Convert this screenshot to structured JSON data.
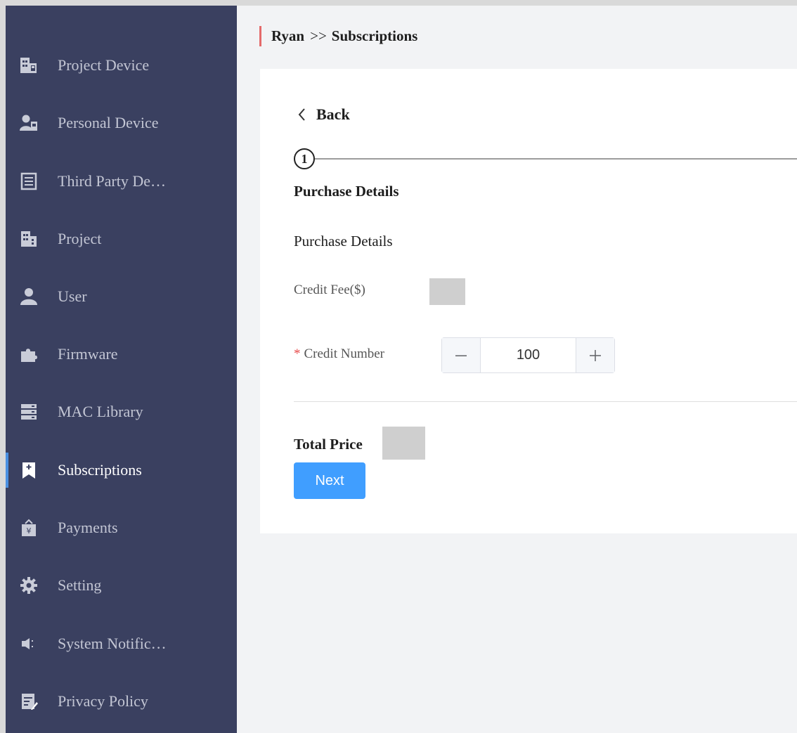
{
  "sidebar": {
    "items": [
      {
        "label": "Project Device",
        "icon": "building-device-icon"
      },
      {
        "label": "Personal Device",
        "icon": "person-device-icon"
      },
      {
        "label": "Third Party De…",
        "icon": "third-party-device-icon"
      },
      {
        "label": "Project",
        "icon": "building-icon"
      },
      {
        "label": "User",
        "icon": "user-icon"
      },
      {
        "label": "Firmware",
        "icon": "puzzle-icon"
      },
      {
        "label": "MAC Library",
        "icon": "server-icon"
      },
      {
        "label": "Subscriptions",
        "icon": "bookmark-plus-icon",
        "active": true
      },
      {
        "label": "Payments",
        "icon": "payment-bag-icon"
      },
      {
        "label": "Setting",
        "icon": "gear-icon"
      },
      {
        "label": "System Notific…",
        "icon": "speaker-icon"
      },
      {
        "label": "Privacy Policy",
        "icon": "policy-document-icon"
      }
    ]
  },
  "breadcrumb": {
    "user": "Ryan",
    "separator": ">>",
    "page": "Subscriptions"
  },
  "back": {
    "label": "Back"
  },
  "steps": {
    "current_number": "1",
    "title": "Purchase Details"
  },
  "form": {
    "section_title": "Purchase Details",
    "credit_fee_label": "Credit Fee($)",
    "credit_number_required_mark": "*",
    "credit_number_label": "Credit Number",
    "credit_number_value": "100",
    "minus_symbol": "−",
    "plus_symbol": "+"
  },
  "total": {
    "label": "Total Price"
  },
  "actions": {
    "next_label": "Next"
  },
  "colors": {
    "sidebar_bg": "#3a4060",
    "primary": "#409eff",
    "breadcrumb_accent": "#e46a6a"
  }
}
